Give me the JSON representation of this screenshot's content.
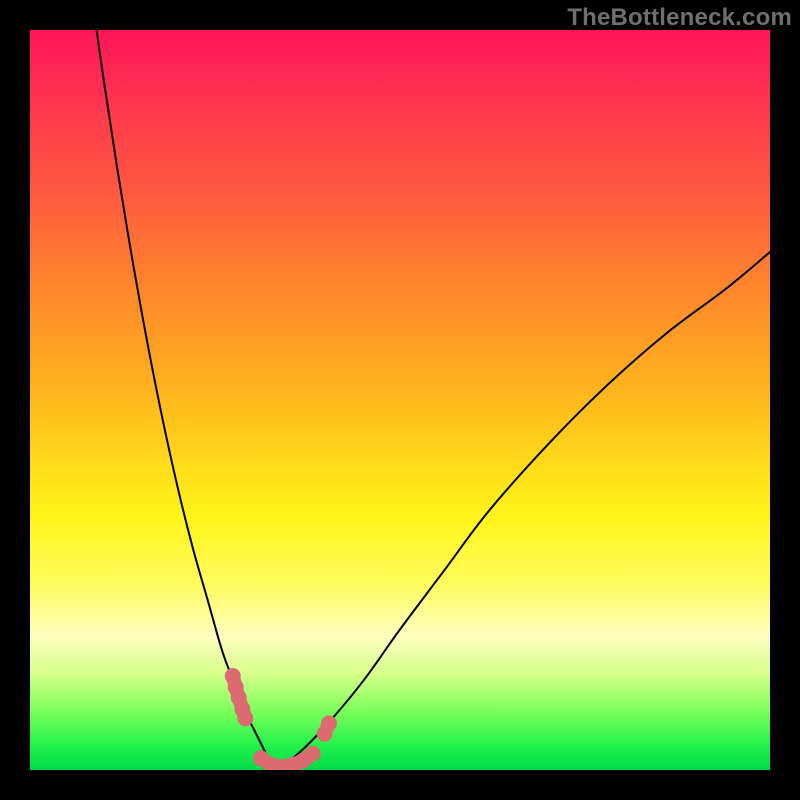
{
  "watermark": "TheBottleneck.com",
  "chart_data": {
    "type": "line",
    "title": "",
    "xlabel": "",
    "ylabel": "",
    "xlim": [
      0,
      100
    ],
    "ylim": [
      0,
      100
    ],
    "grid": false,
    "series": [
      {
        "name": "curve-left",
        "color": "#000000",
        "x": [
          9,
          10,
          12,
          14,
          16,
          18,
          20,
          22,
          24,
          26,
          27.5,
          29,
          30.5,
          32,
          33
        ],
        "y": [
          100,
          93,
          80,
          68,
          57,
          47,
          38,
          30,
          23,
          16,
          12,
          8,
          5,
          2,
          0
        ]
      },
      {
        "name": "curve-right",
        "color": "#000000",
        "x": [
          33,
          36,
          40,
          45,
          50,
          56,
          62,
          70,
          78,
          86,
          94,
          100
        ],
        "y": [
          0,
          2,
          6,
          12,
          19,
          27,
          35,
          44,
          52,
          59,
          65,
          70
        ]
      },
      {
        "name": "markers-left",
        "color": "#db6b71",
        "x": [
          27.4,
          27.8,
          28.2,
          28.7,
          29.1
        ],
        "y": [
          12.7,
          11.2,
          9.8,
          8.2,
          7.0
        ]
      },
      {
        "name": "markers-bottom",
        "color": "#db6b71",
        "x": [
          31.2,
          32.6,
          34.0,
          35.4,
          36.8,
          38.2
        ],
        "y": [
          1.6,
          0.7,
          0.4,
          0.7,
          1.2,
          2.2
        ]
      },
      {
        "name": "markers-right",
        "color": "#db6b71",
        "x": [
          39.8,
          40.4
        ],
        "y": [
          4.9,
          6.3
        ]
      }
    ],
    "background_gradient": {
      "stops": [
        {
          "pos": 0.0,
          "color": "#ff1558"
        },
        {
          "pos": 0.08,
          "color": "#ff2f52"
        },
        {
          "pos": 0.22,
          "color": "#ff5a3f"
        },
        {
          "pos": 0.36,
          "color": "#ff8a2a"
        },
        {
          "pos": 0.48,
          "color": "#ffb21e"
        },
        {
          "pos": 0.58,
          "color": "#ffd81a"
        },
        {
          "pos": 0.66,
          "color": "#fff51a"
        },
        {
          "pos": 0.75,
          "color": "#fffc60"
        },
        {
          "pos": 0.82,
          "color": "#fffec0"
        },
        {
          "pos": 0.87,
          "color": "#d6ff8a"
        },
        {
          "pos": 0.92,
          "color": "#7cff5a"
        },
        {
          "pos": 0.97,
          "color": "#1ef04a"
        },
        {
          "pos": 1.0,
          "color": "#00d94a"
        }
      ]
    }
  }
}
